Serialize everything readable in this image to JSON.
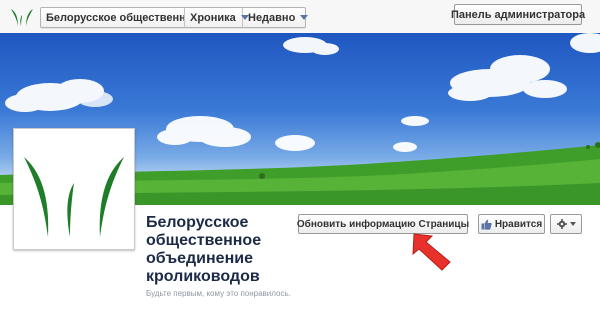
{
  "header": {
    "logo_icon": "leaf-logo-icon",
    "breadcrumbs": [
      {
        "label": "Белорусское общественн..."
      },
      {
        "label": "Хроника"
      },
      {
        "label": "Недавно"
      }
    ],
    "admin_button_label": "Панель администратора"
  },
  "cover": {
    "image": "sky-meadow-landscape",
    "colors": {
      "sky": "#2a66cc",
      "grass": "#3f9d2a"
    }
  },
  "page": {
    "name": "Белорусское общественное объединение кролиководов",
    "likes_note": "Будьте первым, кому это понравилось."
  },
  "actions": {
    "update_info_label": "Обновить информацию Страницы",
    "like_label": "Нравится",
    "like_icon": "thumbs-up-icon",
    "settings_icon": "gear-icon"
  },
  "annotation": {
    "arrow_icon": "red-arrow-icon",
    "color": "#e8312a"
  },
  "brand": {
    "logo_green": "#1f7d2a"
  }
}
